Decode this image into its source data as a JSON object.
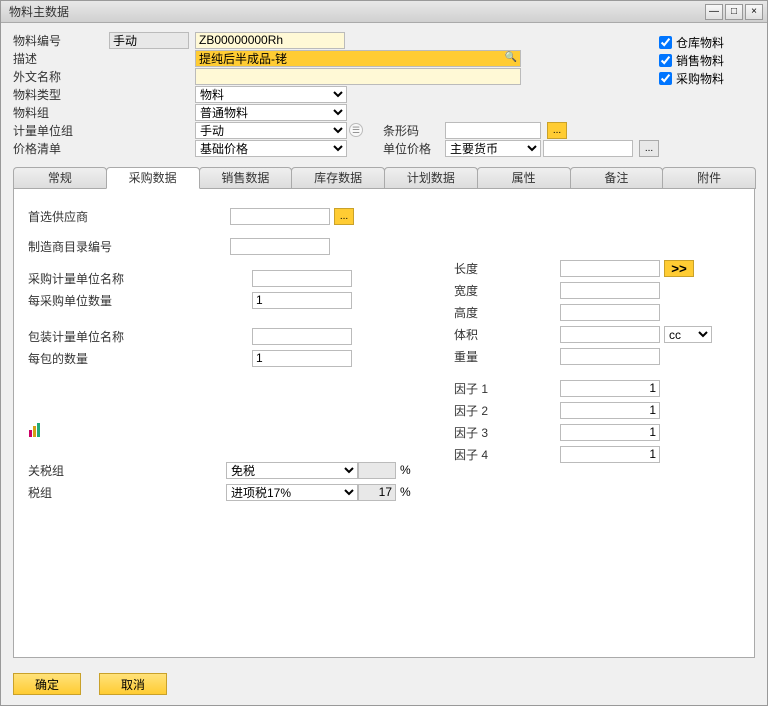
{
  "window": {
    "title": "物料主数据"
  },
  "header": {
    "item_no_label": "物料编号",
    "item_no_mode": "手动",
    "item_no_value": "ZB00000000Rh",
    "desc_label": "描述",
    "desc_value": "提纯后半成品-铑",
    "foreign_name_label": "外文名称",
    "foreign_name_value": "",
    "item_type_label": "物料类型",
    "item_type_value": "物料",
    "item_group_label": "物料组",
    "item_group_value": "普通物料",
    "uom_group_label": "计量单位组",
    "uom_group_value": "手动",
    "price_list_label": "价格清单",
    "price_list_value": "基础价格",
    "barcode_label": "条形码",
    "barcode_value": "",
    "unit_price_label": "单位价格",
    "unit_price_currency": "主要货币",
    "unit_price_value": ""
  },
  "checkboxes": {
    "inventory": "仓库物料",
    "sales": "销售物料",
    "purchase": "采购物料"
  },
  "tabs": [
    "常规",
    "采购数据",
    "销售数据",
    "库存数据",
    "计划数据",
    "属性",
    "备注",
    "附件"
  ],
  "active_tab": 1,
  "purchase_tab": {
    "pref_vendor_label": "首选供应商",
    "pref_vendor_value": "",
    "mfr_catalog_label": "制造商目录编号",
    "mfr_catalog_value": "",
    "purch_uom_label": "采购计量单位名称",
    "purch_uom_value": "",
    "items_per_pu_label": "每采购单位数量",
    "items_per_pu_value": "1",
    "pack_uom_label": "包装计量单位名称",
    "pack_uom_value": "",
    "qty_per_pack_label": "每包的数量",
    "qty_per_pack_value": "1",
    "length_label": "长度",
    "width_label": "宽度",
    "height_label": "高度",
    "volume_label": "体积",
    "volume_unit": "cc",
    "weight_label": "重量",
    "factor1_label": "因子 1",
    "factor1_value": "1",
    "factor2_label": "因子 2",
    "factor2_value": "1",
    "factor3_label": "因子 3",
    "factor3_value": "1",
    "factor4_label": "因子 4",
    "factor4_value": "1",
    "customs_group_label": "关税组",
    "customs_group_value": "免税",
    "customs_pct": "",
    "tax_group_label": "税组",
    "tax_group_value": "进项税17%",
    "tax_pct": "17",
    "percent_sign": "%"
  },
  "footer": {
    "ok": "确定",
    "cancel": "取消"
  },
  "icons": {
    "expand": ">>",
    "ellipsis": "...",
    "link": "⇨"
  }
}
